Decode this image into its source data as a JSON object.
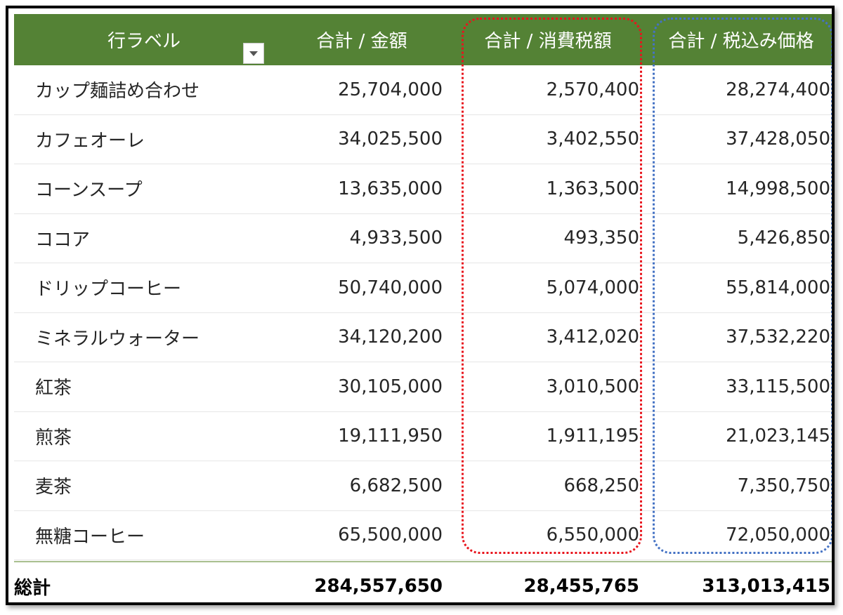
{
  "pivot": {
    "headers": {
      "row_label": "行ラベル",
      "amount": "合計 / 金額",
      "tax": "合計 / 消費税額",
      "tax_included": "合計 / 税込み価格"
    },
    "rows": [
      {
        "label": "カップ麺詰め合わせ",
        "amount": "25,704,000",
        "tax": "2,570,400",
        "tax_included": "28,274,400"
      },
      {
        "label": "カフェオーレ",
        "amount": "34,025,500",
        "tax": "3,402,550",
        "tax_included": "37,428,050"
      },
      {
        "label": "コーンスープ",
        "amount": "13,635,000",
        "tax": "1,363,500",
        "tax_included": "14,998,500"
      },
      {
        "label": "ココア",
        "amount": "4,933,500",
        "tax": "493,350",
        "tax_included": "5,426,850"
      },
      {
        "label": "ドリップコーヒー",
        "amount": "50,740,000",
        "tax": "5,074,000",
        "tax_included": "55,814,000"
      },
      {
        "label": "ミネラルウォーター",
        "amount": "34,120,200",
        "tax": "3,412,020",
        "tax_included": "37,532,220"
      },
      {
        "label": "紅茶",
        "amount": "30,105,000",
        "tax": "3,010,500",
        "tax_included": "33,115,500"
      },
      {
        "label": "煎茶",
        "amount": "19,111,950",
        "tax": "1,911,195",
        "tax_included": "21,023,145"
      },
      {
        "label": "麦茶",
        "amount": "6,682,500",
        "tax": "668,250",
        "tax_included": "7,350,750"
      },
      {
        "label": "無糖コーヒー",
        "amount": "65,500,000",
        "tax": "6,550,000",
        "tax_included": "72,050,000"
      }
    ],
    "total": {
      "label": "総計",
      "amount": "284,557,650",
      "tax": "28,455,765",
      "tax_included": "313,013,415"
    }
  },
  "colors": {
    "header_bg": "#548235",
    "highlight_red": "#e8141c",
    "highlight_blue": "#4472c4"
  },
  "icons": {
    "filter": "dropdown-arrow-icon"
  }
}
